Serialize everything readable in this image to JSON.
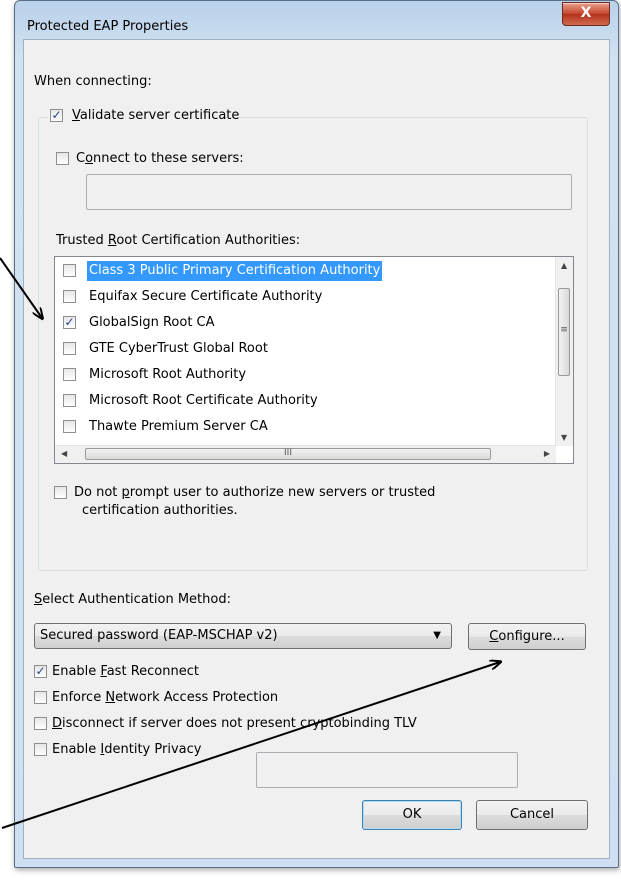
{
  "window": {
    "title": "Protected EAP Properties",
    "close_glyph": "X"
  },
  "connecting": {
    "label": "When connecting:",
    "validate_cert": {
      "checked": true,
      "pre": "",
      "accel": "V",
      "post": "alidate server certificate"
    },
    "connect_servers": {
      "checked": false,
      "pre": "C",
      "accel": "o",
      "post": "nnect to these servers:"
    },
    "servers_value": "",
    "trusted_label": {
      "pre": "Trusted ",
      "accel": "R",
      "post": "oot Certification Authorities:"
    },
    "authorities": [
      {
        "label": "Class 3 Public Primary Certification Authority",
        "checked": false,
        "selected": true
      },
      {
        "label": "Equifax Secure Certificate Authority",
        "checked": false,
        "selected": false
      },
      {
        "label": "GlobalSign Root CA",
        "checked": true,
        "selected": false
      },
      {
        "label": "GTE CyberTrust Global Root",
        "checked": false,
        "selected": false
      },
      {
        "label": "Microsoft Root Authority",
        "checked": false,
        "selected": false
      },
      {
        "label": "Microsoft Root Certificate Authority",
        "checked": false,
        "selected": false
      },
      {
        "label": "Thawte Premium Server CA",
        "checked": false,
        "selected": false
      }
    ],
    "scroll_thumb_glyph_v": "≡",
    "scroll_thumb_glyph_h": "III",
    "no_prompt": {
      "checked": false,
      "line1_pre": "Do not ",
      "line1_accel": "p",
      "line1_post": "rompt user to authorize new servers or trusted",
      "line2": "certification authorities."
    }
  },
  "auth": {
    "label_accel": "S",
    "label_post": "elect Authentication Method:",
    "method_value": "Secured password (EAP-MSCHAP v2)",
    "configure_accel": "C",
    "configure_post": "onfigure..."
  },
  "options": [
    {
      "checked": true,
      "pre": "Enable ",
      "accel": "F",
      "post": "ast Reconnect"
    },
    {
      "checked": false,
      "pre": "Enforce ",
      "accel": "N",
      "post": "etwork Access Protection"
    },
    {
      "checked": false,
      "pre": "",
      "accel": "D",
      "post": "isconnect if server does not present cryptobinding TLV"
    },
    {
      "checked": false,
      "pre": "Enable ",
      "accel": "I",
      "post": "dentity Privacy"
    }
  ],
  "identity_value": "",
  "buttons": {
    "ok": "OK",
    "cancel": "Cancel"
  },
  "colors": {
    "selection": "#3399ff",
    "annotation_arrow": "#000000",
    "close_button": "#c7442b"
  }
}
